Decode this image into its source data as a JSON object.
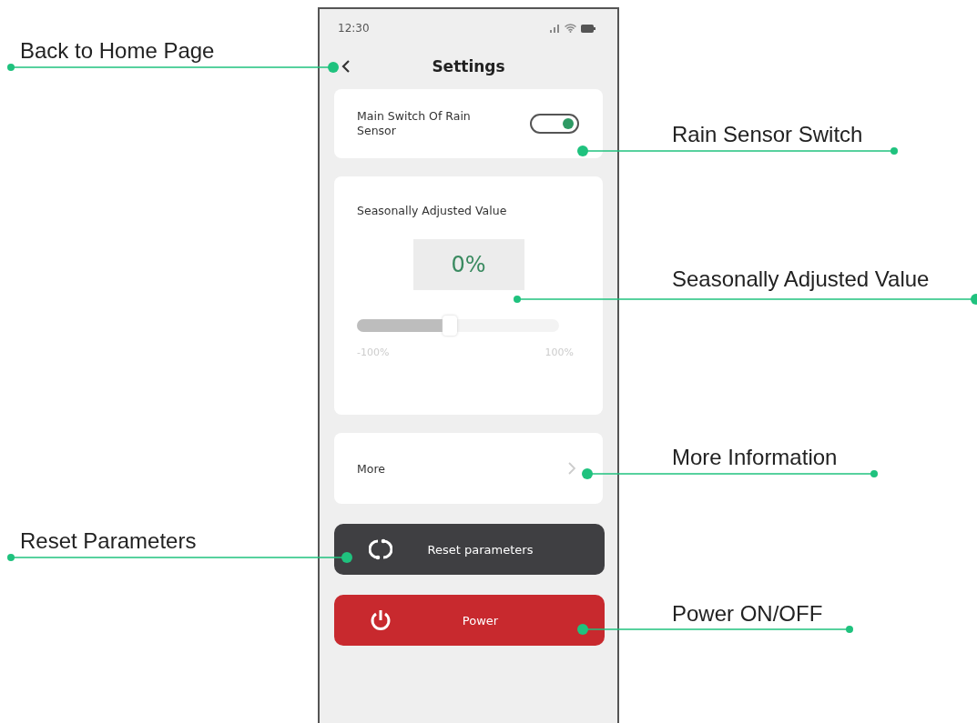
{
  "phone": {
    "status_bar": {
      "time": "12:30"
    },
    "header": {
      "title": "Settings"
    },
    "rain_sensor": {
      "label": "Main Switch Of Rain Sensor",
      "on": true
    },
    "seasonal": {
      "title": "Seasonally Adjusted Value",
      "value": "0%",
      "level": 0.45,
      "min_label": "-100%",
      "max_label": "100%"
    },
    "more": {
      "label": "More"
    },
    "buttons": [
      {
        "kind": "reset",
        "label": "Reset parameters"
      },
      {
        "kind": "power",
        "label": "Power"
      }
    ]
  },
  "annotations": [
    {
      "label": "Back to Home Page"
    },
    {
      "label": "Rain Sensor Switch"
    },
    {
      "label": "Seasonally Adjusted Value"
    },
    {
      "label": "More Information"
    },
    {
      "label": "Reset Parameters"
    },
    {
      "label": "Power ON/OFF"
    }
  ]
}
